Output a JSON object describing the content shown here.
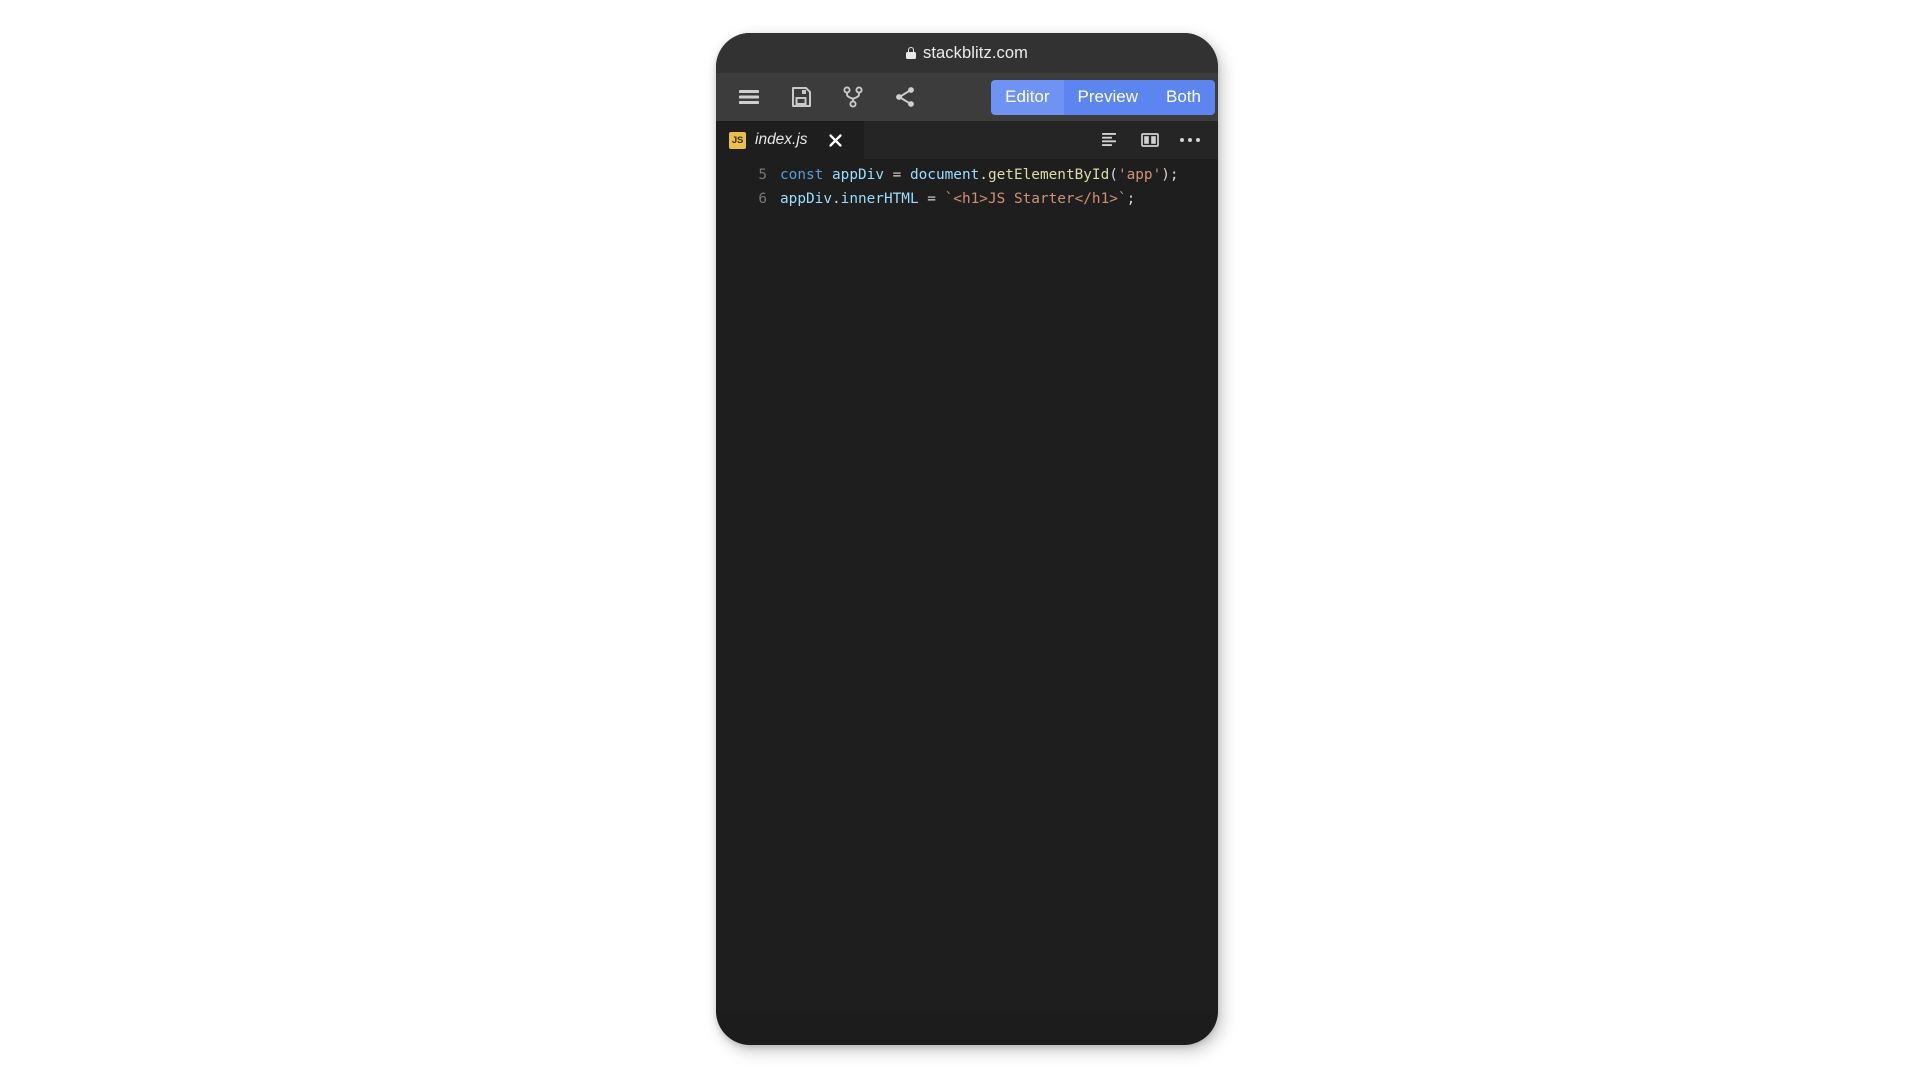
{
  "browser": {
    "lock_icon": "lock-icon",
    "host": "stackblitz.com"
  },
  "toolbar": {
    "menu_icon": "hamburger-menu-icon",
    "save_icon": "save-floppy-icon",
    "fork_icon": "fork-branch-icon",
    "share_icon": "share-icon",
    "view_modes": [
      {
        "label": "Editor",
        "active": true
      },
      {
        "label": "Preview",
        "active": false
      },
      {
        "label": "Both",
        "active": false
      }
    ]
  },
  "editor": {
    "tab": {
      "badge": "JS",
      "filename": "index.js",
      "close_icon": "close-icon"
    },
    "actions": [
      {
        "icon": "format-lines-icon"
      },
      {
        "icon": "split-pane-icon"
      },
      {
        "icon": "more-options-icon"
      }
    ],
    "lines": [
      {
        "number": "5",
        "text": "const appDiv = document.getElementById('app');",
        "tokens": [
          {
            "text": "const",
            "type": "keyword"
          },
          {
            "text": " ",
            "type": "plain"
          },
          {
            "text": "appDiv",
            "type": "variable"
          },
          {
            "text": " = ",
            "type": "plain"
          },
          {
            "text": "document",
            "type": "variable"
          },
          {
            "text": ".",
            "type": "plain"
          },
          {
            "text": "getElementById",
            "type": "function"
          },
          {
            "text": "(",
            "type": "plain"
          },
          {
            "text": "'app'",
            "type": "string"
          },
          {
            "text": ");",
            "type": "plain"
          }
        ]
      },
      {
        "number": "6",
        "text": "appDiv.innerHTML = `<h1>JS Starter</h1>`;",
        "tokens": [
          {
            "text": "appDiv",
            "type": "variable"
          },
          {
            "text": ".",
            "type": "plain"
          },
          {
            "text": "innerHTML",
            "type": "variable"
          },
          {
            "text": " = ",
            "type": "plain"
          },
          {
            "text": "`<h1>JS Starter</h1>`",
            "type": "string"
          },
          {
            "text": ";",
            "type": "plain"
          }
        ]
      }
    ]
  },
  "colors": {
    "accent_blue": "#5c85f0",
    "accent_blue_active": "#6f93f2",
    "js_badge": "#e8c04a",
    "editor_bg": "#1e1e1e",
    "tabbar_bg": "#252526",
    "toolbar_bg": "#3c3c3c",
    "urlbar_bg": "#323232",
    "page_bg": "#ffffff",
    "token_keyword": "#569cd6",
    "token_variable": "#9cdcfe",
    "token_function": "#dcdcaa",
    "token_string": "#ce9178",
    "token_plain": "#d4d4d4"
  }
}
